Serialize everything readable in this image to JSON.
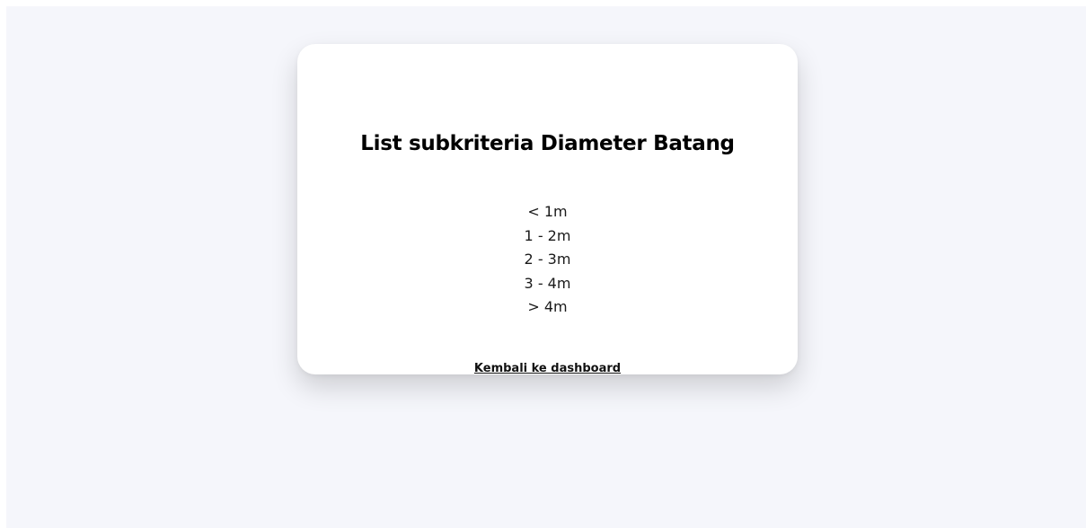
{
  "card": {
    "title": "List subkriteria Diameter Batang",
    "subcriteria": [
      "< 1m",
      "1 - 2m",
      "2 - 3m",
      "3 - 4m",
      "> 4m"
    ],
    "back_link_label": "Kembali ke dashboard"
  },
  "colors": {
    "page_background": "#f5f6fb",
    "card_background": "#ffffff",
    "text": "#000000"
  }
}
